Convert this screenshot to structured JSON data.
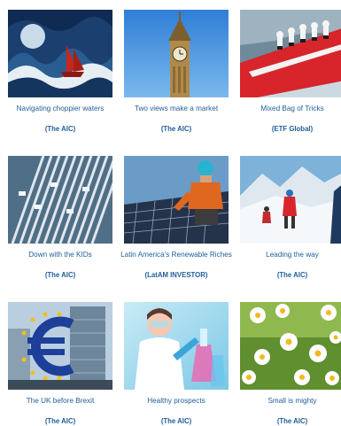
{
  "articles": [
    {
      "title": "Navigating choppier waters",
      "source": "(The AIC)",
      "thumb_icon": "ship-in-storm-image"
    },
    {
      "title": "Two views make a market",
      "source": "(The AIC)",
      "thumb_icon": "big-ben-image"
    },
    {
      "title": "Mixed Bag of Tricks",
      "source": "(ETF Global)",
      "thumb_icon": "sailing-crew-image"
    },
    {
      "title": "Down with the KIDs",
      "source": "(The AIC)",
      "thumb_icon": "file-folders-image"
    },
    {
      "title": "Latin America's Renewable Riches",
      "source": "(LatAM INVESTOR)",
      "thumb_icon": "solar-panel-worker-image"
    },
    {
      "title": "Leading the way",
      "source": "(The AIC)",
      "thumb_icon": "mountain-hikers-image"
    },
    {
      "title": "The UK before Brexit",
      "source": "(The AIC)",
      "thumb_icon": "euro-sign-image"
    },
    {
      "title": "Healthy prospects",
      "source": "(The AIC)",
      "thumb_icon": "lab-scientist-image"
    },
    {
      "title": "Small is mighty",
      "source": "(The AIC)",
      "thumb_icon": "daisy-field-image"
    }
  ]
}
